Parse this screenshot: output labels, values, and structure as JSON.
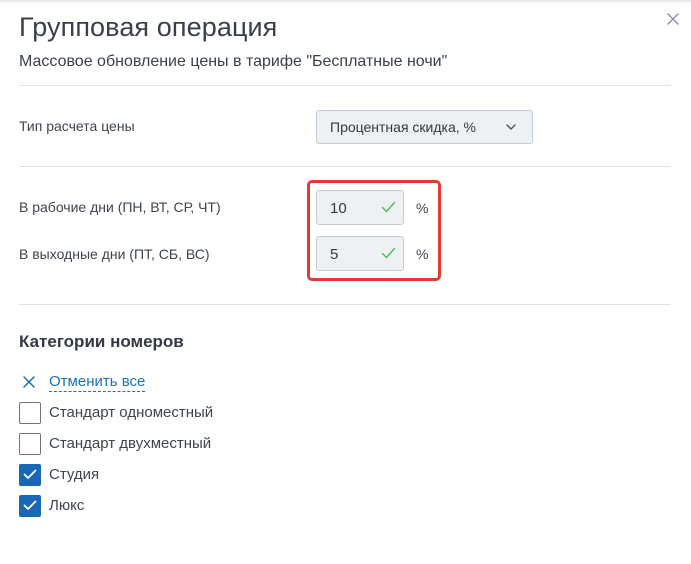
{
  "dialog": {
    "title": "Групповая операция",
    "subtitle": "Массовое обновление цены в тарифе \"Бесплатные ночи\"",
    "close_icon": "close-icon"
  },
  "price_calc": {
    "label": "Тип расчета цены",
    "selected": "Процентная скидка, %",
    "chevron_icon": "chevron-down-icon"
  },
  "weekdays": {
    "label": "В рабочие дни (ПН, ВТ, СР, ЧТ)",
    "value": "10",
    "unit": "%"
  },
  "weekends": {
    "label": "В выходные дни (ПТ, СБ, ВС)",
    "value": "5",
    "unit": "%"
  },
  "colors": {
    "accent": "#1a67b5",
    "link": "#1d6fb8",
    "valid_check": "#5cb85c",
    "highlight": "#e53935"
  },
  "room_categories": {
    "title": "Категории номеров",
    "cancel_all": "Отменить все",
    "items": [
      {
        "label": "Стандарт одноместный",
        "checked": false
      },
      {
        "label": "Стандарт двухместный",
        "checked": false
      },
      {
        "label": "Студия",
        "checked": true
      },
      {
        "label": "Люкс",
        "checked": true
      }
    ]
  }
}
